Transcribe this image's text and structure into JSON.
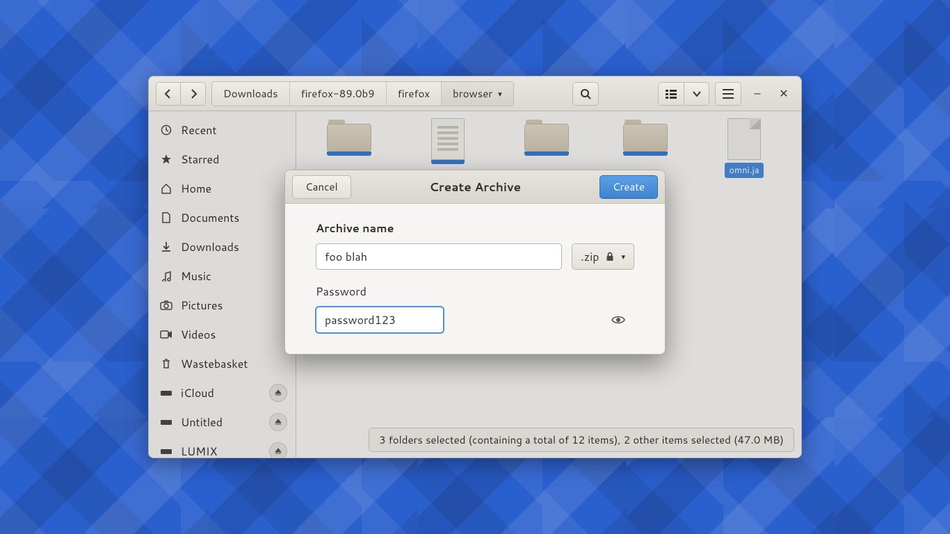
{
  "breadcrumbs": [
    "Downloads",
    "firefox-89.0b9",
    "firefox",
    "browser"
  ],
  "sidebar": {
    "items": [
      {
        "label": "Recent",
        "icon": "clock-icon",
        "ejectable": false
      },
      {
        "label": "Starred",
        "icon": "star-icon",
        "ejectable": false
      },
      {
        "label": "Home",
        "icon": "home-icon",
        "ejectable": false
      },
      {
        "label": "Documents",
        "icon": "document-icon",
        "ejectable": false
      },
      {
        "label": "Downloads",
        "icon": "download-icon",
        "ejectable": false
      },
      {
        "label": "Music",
        "icon": "music-icon",
        "ejectable": false
      },
      {
        "label": "Pictures",
        "icon": "camera-icon",
        "ejectable": false
      },
      {
        "label": "Videos",
        "icon": "video-icon",
        "ejectable": false
      },
      {
        "label": "Wastebasket",
        "icon": "trash-icon",
        "ejectable": false
      },
      {
        "label": "iCloud",
        "icon": "drive-icon",
        "ejectable": true
      },
      {
        "label": "Untitled",
        "icon": "drive-icon",
        "ejectable": true
      },
      {
        "label": "LUMIX",
        "icon": "drive-icon",
        "ejectable": true
      }
    ]
  },
  "files": [
    {
      "kind": "folder",
      "name": "",
      "selected": true
    },
    {
      "kind": "textfile",
      "name": "",
      "selected": true
    },
    {
      "kind": "folder",
      "name": "",
      "selected": true
    },
    {
      "kind": "folder",
      "name": "",
      "selected": true
    },
    {
      "kind": "generic",
      "name": "omni.ja",
      "selected": true
    }
  ],
  "statusbar": "3 folders selected (containing a total of 12 items), 2 other items selected (47.0 MB)",
  "dialog": {
    "title": "Create Archive",
    "cancel_label": "Cancel",
    "create_label": "Create",
    "archive_name_label": "Archive name",
    "archive_name_value": "foo blah",
    "extension": ".zip",
    "password_label": "Password",
    "password_value": "password123"
  },
  "colors": {
    "accent": "#4a90e2",
    "primary_button": "#4a8fd6"
  }
}
